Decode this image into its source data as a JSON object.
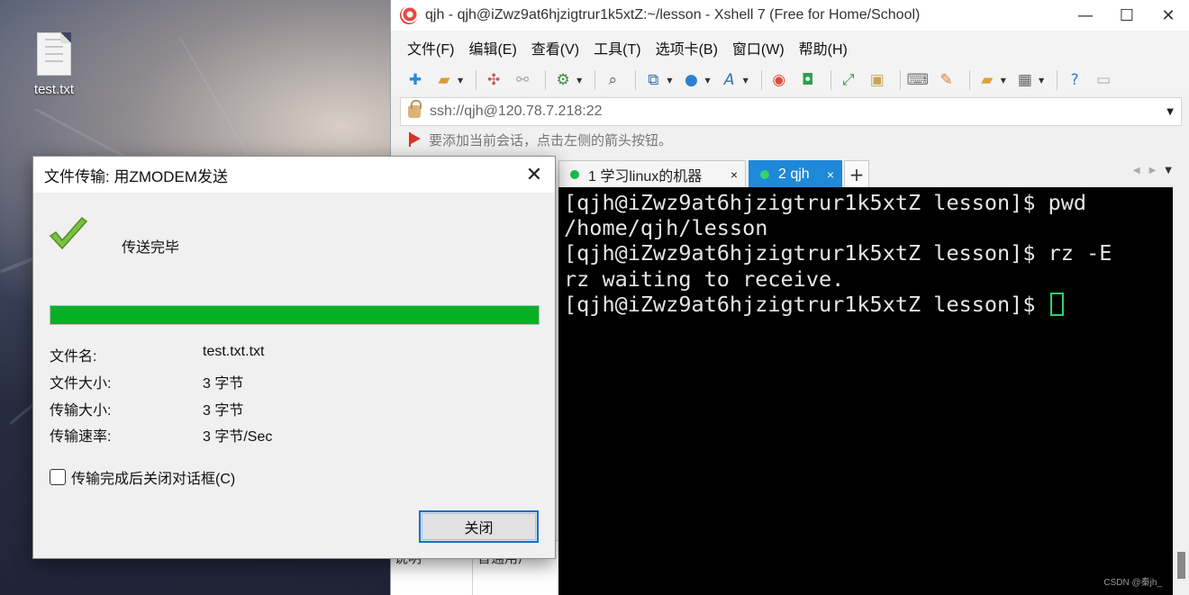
{
  "desktop": {
    "icon_label": "test.txt"
  },
  "xshell": {
    "title": "qjh - qjh@iZwz9at6hjzigtrur1k5xtZ:~/lesson - Xshell 7 (Free for Home/School)",
    "window_controls": {
      "minimize": "—",
      "maximize": "☐",
      "close": "✕"
    },
    "menu": [
      "文件(F)",
      "编辑(E)",
      "查看(V)",
      "工具(T)",
      "选项卡(B)",
      "窗口(W)",
      "帮助(H)"
    ],
    "address": "ssh://qjh@120.78.7.218:22",
    "hint": "要添加当前会话，点击左侧的箭头按钮。",
    "tabs": [
      {
        "label": "1 学习linux的机器",
        "close": "×"
      },
      {
        "label": "2 qjh",
        "close": "×"
      }
    ],
    "tab_add": "+",
    "terminal_lines": [
      "[qjh@iZwz9at6hjzigtrur1k5xtZ lesson]$ pwd",
      "/home/qjh/lesson",
      "[qjh@iZwz9at6hjzigtrur1k5xtZ lesson]$ rz -E",
      "rz waiting to receive.",
      "[qjh@iZwz9at6hjzigtrur1k5xtZ lesson]$ "
    ],
    "bottom_panel": {
      "col1": "说明",
      "col2": "普通用户"
    },
    "watermark": "CSDN @秦jh_"
  },
  "dialog": {
    "title": "文件传输: 用ZMODEM发送",
    "close_glyph": "✕",
    "status": "传送完毕",
    "progress_fraction": 1.0,
    "fields": [
      {
        "label": "文件名:",
        "value": "test.txt.txt"
      },
      {
        "label": "文件大小:",
        "value": "3 字节"
      },
      {
        "label": "传输大小:",
        "value": "3 字节"
      },
      {
        "label": "传输速率:",
        "value": "3 字节/Sec"
      }
    ],
    "auto_close_label": "传输完成后关闭对话框(C)",
    "auto_close_checked": false,
    "close_button": "关闭"
  },
  "colors": {
    "progress": "#06b025",
    "active_tab": "#1e88d9",
    "cursor": "#2fd16a",
    "terminal_bg": "#000000"
  }
}
